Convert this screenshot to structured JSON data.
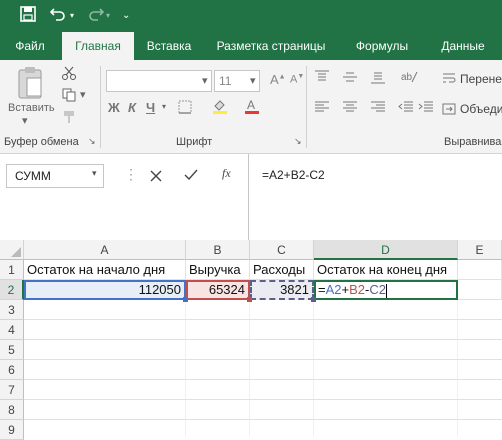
{
  "ribbon_tabs": [
    "Файл",
    "Главная",
    "Вставка",
    "Разметка страницы",
    "Формулы",
    "Данные"
  ],
  "clipboard": {
    "paste_label": "Вставить",
    "group_label": "Буфер обмена"
  },
  "font": {
    "name": "",
    "size": "11",
    "bold": "Ж",
    "italic": "К",
    "underline": "Ч",
    "group_label": "Шрифт"
  },
  "alignment": {
    "wrap_label": "Перене",
    "merge_label": "Объеди",
    "group_label": "Выравнива"
  },
  "formula_bar": {
    "namebox": "СУММ",
    "formula": "=A2+B2-C2",
    "fx": "fx"
  },
  "grid": {
    "columns": [
      "A",
      "B",
      "C",
      "D",
      "E"
    ],
    "rows": [
      "1",
      "2",
      "3",
      "4",
      "5",
      "6",
      "7",
      "8",
      "9"
    ],
    "row1": [
      "Остаток на начало дня",
      "Выручка",
      "Расходы",
      "Остаток на конец дня"
    ],
    "row2": {
      "a": "112050",
      "b": "65324",
      "c": "3821",
      "eq": "=",
      "ref1": "A2",
      "op1": "+",
      "ref2": "B2",
      "op2": "-",
      "ref3": "C2"
    }
  },
  "colors": {
    "accent": "#217346",
    "ref_a": "#4472c4",
    "ref_b": "#c0504d",
    "ref_c": "#5b5f8c"
  }
}
